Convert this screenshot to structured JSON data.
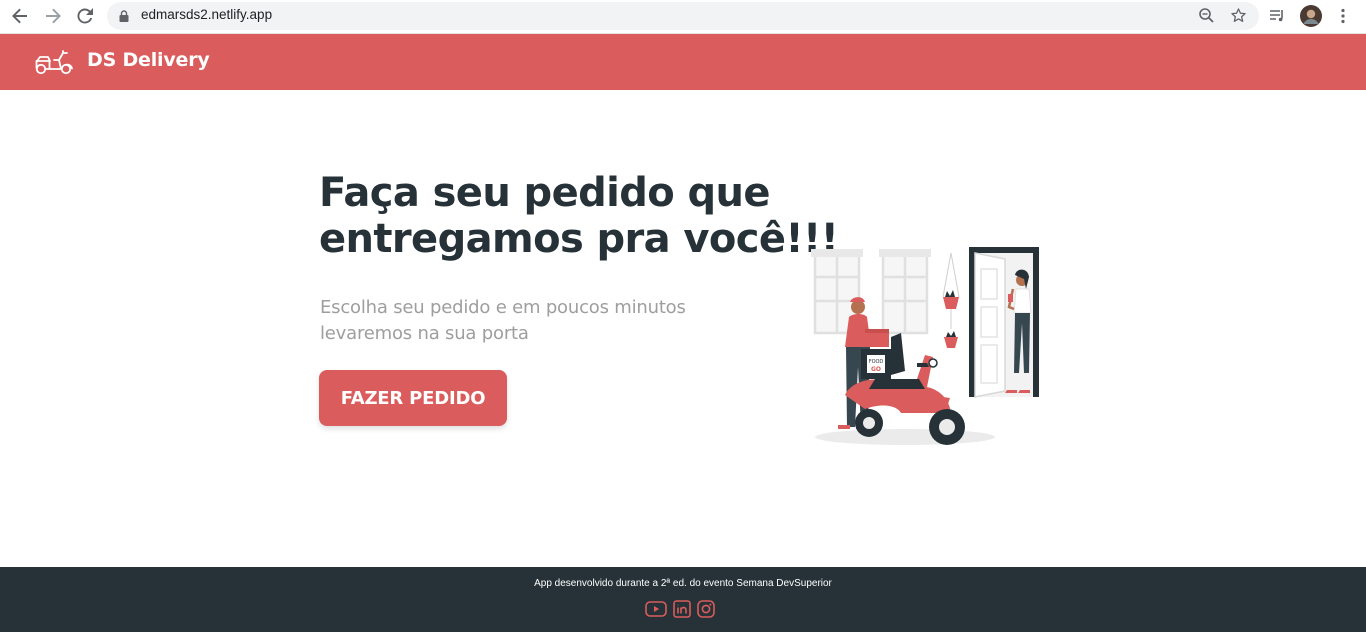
{
  "browser": {
    "url": "edmarsds2.netlify.app",
    "icons": [
      "back-arrow-icon",
      "forward-arrow-icon",
      "reload-icon",
      "lock-icon",
      "zoom-icon",
      "star-icon",
      "media-queue-icon",
      "profile-avatar",
      "kebab-menu-icon"
    ]
  },
  "header": {
    "title": "DS Delivery",
    "logo_icon": "scooter-icon"
  },
  "hero": {
    "title": "Faça seu pedido que entregamos pra você!!!",
    "subtitle": "Escolha seu pedido e em poucos minutos levaremos na sua porta",
    "button_label": "FAZER PEDIDO",
    "illustration": "delivery-scooter-illustration"
  },
  "footer": {
    "text": "App desenvolvido durante a 2ª ed. do evento Semana DevSuperior",
    "social_icons": [
      "youtube-icon",
      "linkedin-icon",
      "instagram-icon"
    ]
  },
  "colors": {
    "brand": "#da5c5c",
    "dark": "#263238",
    "muted": "#9e9e9e"
  }
}
